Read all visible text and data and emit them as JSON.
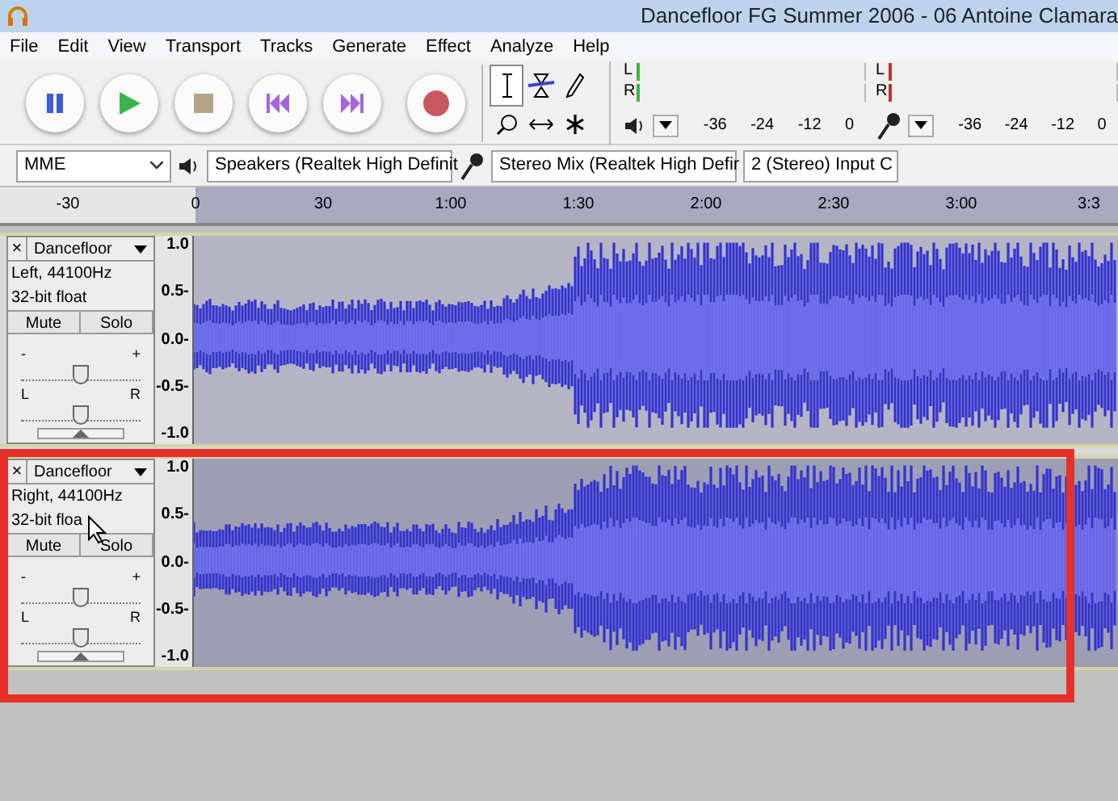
{
  "window": {
    "title": "Dancefloor FG Summer 2006 - 06 Antoine Clamara"
  },
  "menu": [
    "File",
    "Edit",
    "View",
    "Transport",
    "Tracks",
    "Generate",
    "Effect",
    "Analyze",
    "Help"
  ],
  "transport_buttons": [
    {
      "kind": "pause"
    },
    {
      "kind": "play"
    },
    {
      "kind": "stop"
    },
    {
      "kind": "skip_start"
    },
    {
      "kind": "skip_end"
    },
    {
      "kind": "record"
    }
  ],
  "meters": [
    {
      "kind": "output",
      "channels": [
        "L",
        "R"
      ],
      "ticks": [
        "-36",
        "-24",
        "-12",
        "0"
      ]
    },
    {
      "kind": "input",
      "channels": [
        "L",
        "R"
      ],
      "ticks": [
        "-36",
        "-24",
        "-12",
        "0"
      ]
    }
  ],
  "device_bar": {
    "host": "MME",
    "output": "Speakers (Realtek High Definit",
    "input": "Stereo Mix (Realtek High Defir",
    "channels": "2 (Stereo) Input C"
  },
  "ruler": {
    "labels": [
      "-30",
      "0",
      "30",
      "1:00",
      "1:30",
      "2:00",
      "2:30",
      "3:00",
      "3:3"
    ]
  },
  "tracks": [
    {
      "close": "×",
      "name": "Dancefloor",
      "info": [
        "Left, 44100Hz",
        "32-bit float"
      ],
      "buttons": [
        "Mute",
        "Solo"
      ],
      "gain": {
        "min_label": "-",
        "max_label": "+",
        "level": 0.5
      },
      "pan": {
        "min_label": "L",
        "max_label": "R",
        "level": 0.5
      },
      "scale": [
        "1.0",
        "0.5-",
        "0.0-",
        "-0.5-",
        "-1.0"
      ],
      "selected": false,
      "highlighted": false
    },
    {
      "close": "×",
      "name": "Dancefloor",
      "info": [
        "Right, 44100Hz",
        "32-bit floa"
      ],
      "buttons": [
        "Mute",
        "Solo"
      ],
      "gain": {
        "min_label": "-",
        "max_label": "+",
        "level": 0.5
      },
      "pan": {
        "min_label": "L",
        "max_label": "R",
        "level": 0.5
      },
      "scale": [
        "1.0",
        "0.5-",
        "0.0-",
        "-0.5-",
        "-1.0"
      ],
      "selected": true,
      "highlighted": true
    }
  ]
}
